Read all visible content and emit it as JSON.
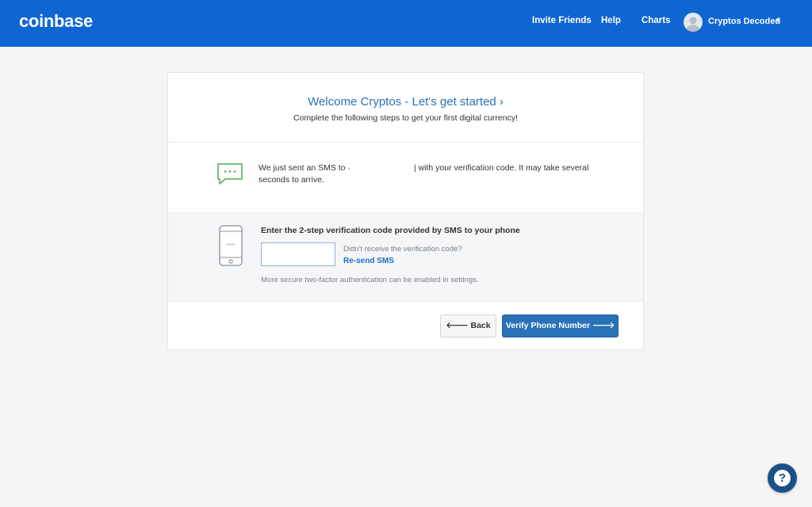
{
  "header": {
    "logo": "coinbase",
    "nav": [
      "Invite Friends",
      "Help",
      "Charts"
    ],
    "user_name": "Cryptos Decoded"
  },
  "card": {
    "title": "Welcome Cryptos - Let's get started ›",
    "subtitle": "Complete the following steps to get your first digital currency!",
    "sms_prefix": "We just sent an SMS to ·",
    "sms_suffix": "| with your verification code. It may take several seconds to arrive.",
    "verify_label": "Enter the 2-step verification code provided by SMS to your phone",
    "code_value": "",
    "didnt_receive": "Didn't receive the verification code?",
    "resend": "Re-send SMS",
    "more_secure": "More secure two-factor authentication can be enabled in settings.",
    "back_label": "🡐 Back",
    "verify_label_btn": "Verify Phone Number 🡒"
  },
  "help_fab": "?",
  "colors": {
    "brand_blue": "#0f66d2",
    "button_blue": "#2a72b8",
    "sms_green": "#4caf50"
  },
  "icons": [
    "sms-bubble-icon",
    "phone-icon",
    "arrow-left-icon",
    "arrow-right-icon",
    "question-icon",
    "avatar-icon",
    "caret-down-icon"
  ]
}
